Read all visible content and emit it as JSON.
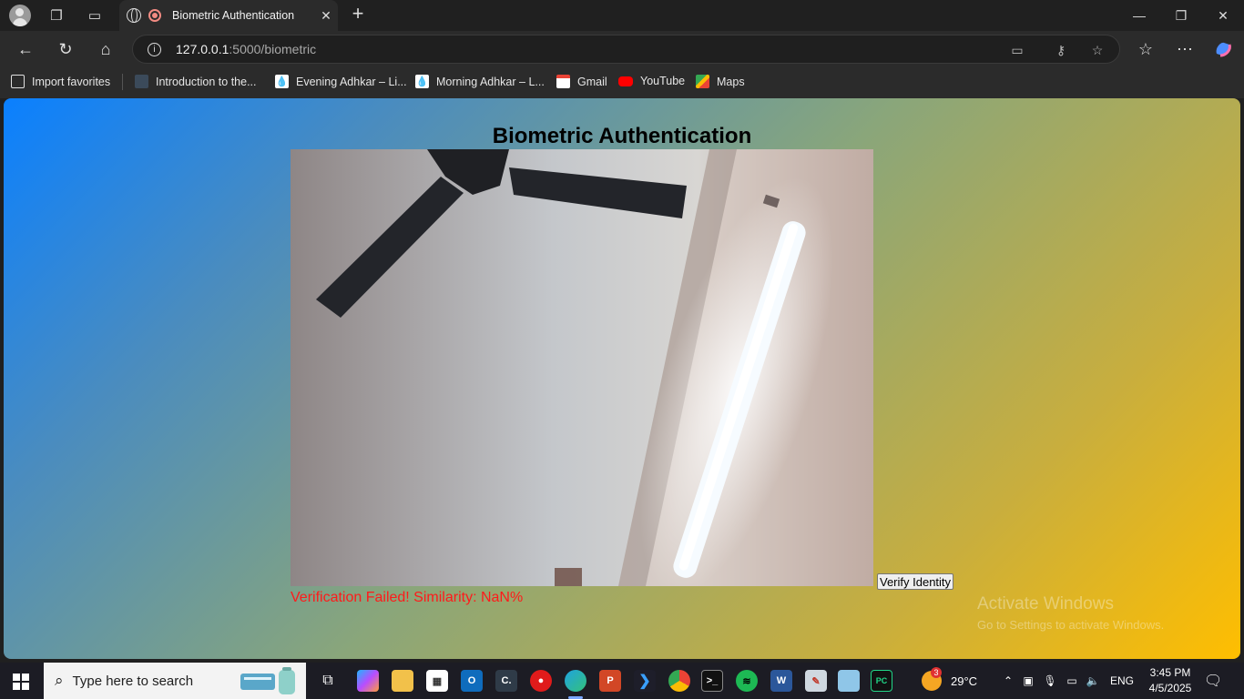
{
  "browser": {
    "tab_title": "Biometric Authentication",
    "url_host": "127.0.0.1",
    "url_path": ":5000/biometric",
    "bookmarks": [
      {
        "label": "Import favorites",
        "icon": "import-icon",
        "color": "#e0e0e0"
      },
      {
        "label": "Introduction to the...",
        "icon": "page-icon",
        "color": "#3b4a5a"
      },
      {
        "label": "Evening Adhkar – Li...",
        "icon": "drop-icon",
        "color": "#ffffff"
      },
      {
        "label": "Morning Adhkar – L...",
        "icon": "drop-icon",
        "color": "#ffffff"
      },
      {
        "label": "Gmail",
        "icon": "gmail-icon",
        "color": "#ea4335"
      },
      {
        "label": "YouTube",
        "icon": "youtube-icon",
        "color": "#ff0000"
      },
      {
        "label": "Maps",
        "icon": "maps-icon",
        "color": "#34a853"
      }
    ]
  },
  "page": {
    "title": "Biometric Authentication",
    "verify_button": "Verify Identity",
    "result_text": "Verification Failed! Similarity: NaN%",
    "result_color": "#ff1a1a"
  },
  "watermark": {
    "line1": "Activate Windows",
    "line2": "Go to Settings to activate Windows."
  },
  "taskbar": {
    "search_placeholder": "Type here to search",
    "weather_badge": "3",
    "temperature": "29°C",
    "language": "ENG",
    "time": "3:45 PM",
    "date": "4/5/2025"
  }
}
